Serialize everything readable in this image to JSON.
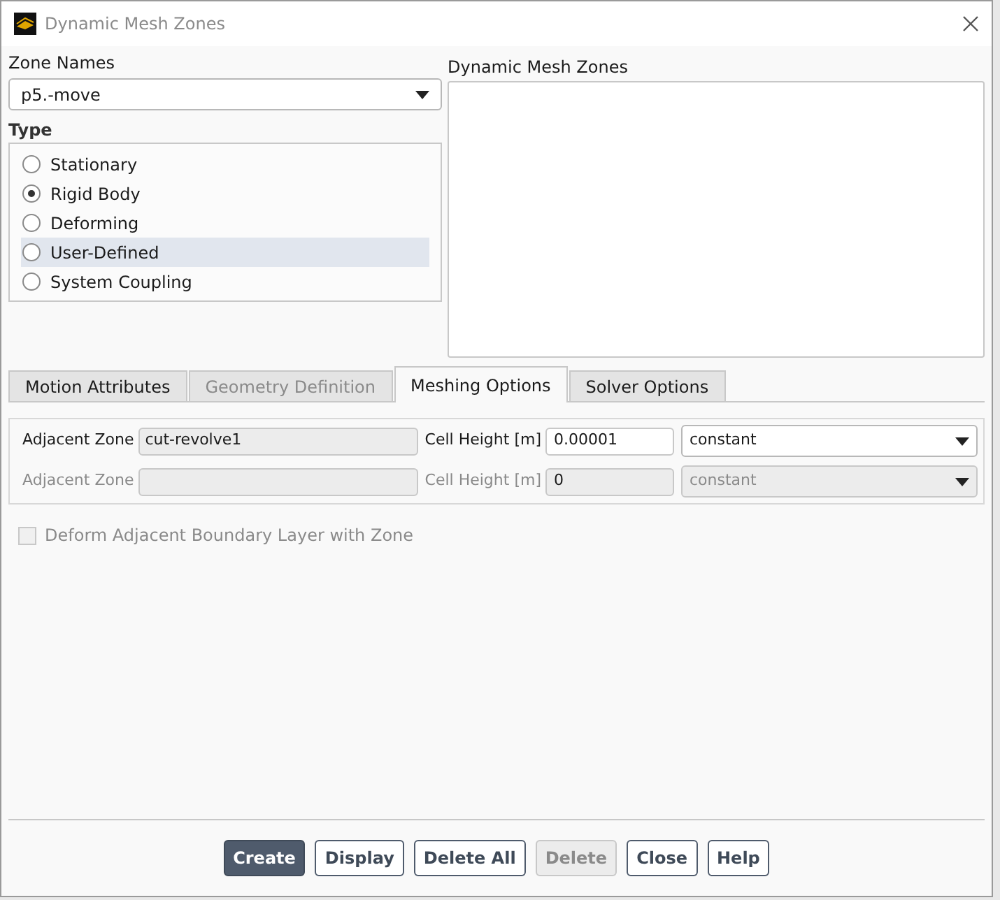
{
  "window": {
    "title": "Dynamic Mesh Zones"
  },
  "zone_names": {
    "label": "Zone Names",
    "value": "p5.-move"
  },
  "type": {
    "label": "Type",
    "options": [
      {
        "label": "Stationary",
        "selected": false,
        "highlighted": false
      },
      {
        "label": "Rigid Body",
        "selected": true,
        "highlighted": false
      },
      {
        "label": "Deforming",
        "selected": false,
        "highlighted": false
      },
      {
        "label": "User-Defined",
        "selected": false,
        "highlighted": true
      },
      {
        "label": "System Coupling",
        "selected": false,
        "highlighted": false
      }
    ]
  },
  "dynamic_mesh_zones": {
    "label": "Dynamic Mesh Zones"
  },
  "tabs": [
    {
      "label": "Motion Attributes",
      "selected": false,
      "disabled": false
    },
    {
      "label": "Geometry Definition",
      "selected": false,
      "disabled": true
    },
    {
      "label": "Meshing Options",
      "selected": true,
      "disabled": false
    },
    {
      "label": "Solver Options",
      "selected": false,
      "disabled": false
    }
  ],
  "meshing_rows": [
    {
      "zone_label": "Adjacent Zone",
      "zone_value": "cut-revolve1",
      "height_label": "Cell Height [m]",
      "height_value": "0.00001",
      "profile": "constant",
      "disabled": false
    },
    {
      "zone_label": "Adjacent Zone",
      "height_label": "Cell Height [m]",
      "height_value": "0",
      "profile": "constant",
      "disabled": true
    }
  ],
  "deform_checkbox": {
    "label": "Deform Adjacent Boundary Layer with Zone",
    "checked": false,
    "disabled": true
  },
  "buttons": [
    {
      "label": "Create",
      "kind": "primary"
    },
    {
      "label": "Display",
      "kind": "normal"
    },
    {
      "label": "Delete All",
      "kind": "normal"
    },
    {
      "label": "Delete",
      "kind": "disabled"
    },
    {
      "label": "Close",
      "kind": "normal"
    },
    {
      "label": "Help",
      "kind": "normal"
    }
  ]
}
